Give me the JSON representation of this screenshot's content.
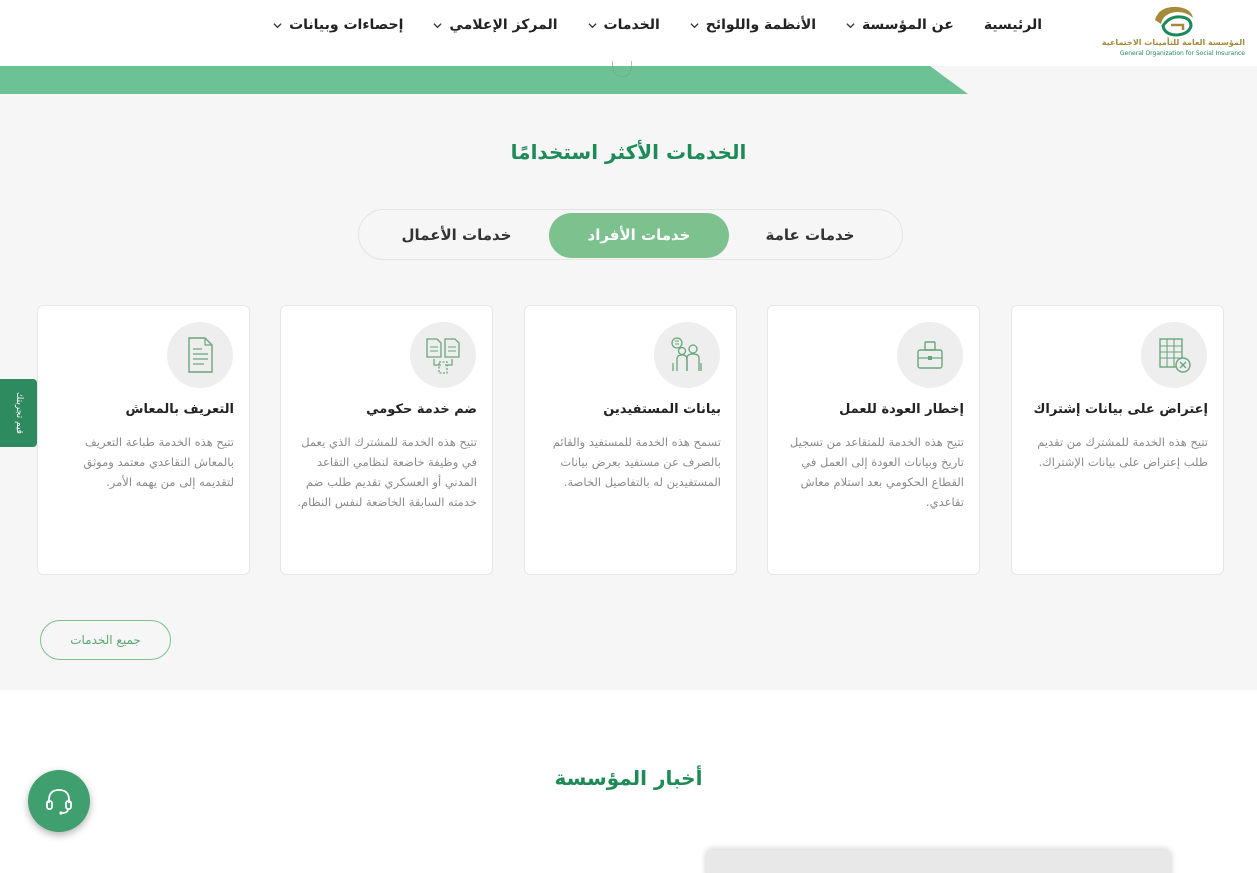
{
  "logo": {
    "arabic": "المؤسسة العامة للتأمينات الاجتماعية",
    "english": "General Organization for Social Insurance"
  },
  "nav": [
    {
      "label": "الرئيسية",
      "has_dropdown": false
    },
    {
      "label": "عن المؤسسة",
      "has_dropdown": true
    },
    {
      "label": "الأنظمة واللوائح",
      "has_dropdown": true
    },
    {
      "label": "الخدمات",
      "has_dropdown": true
    },
    {
      "label": "المركز الإعلامي",
      "has_dropdown": true
    },
    {
      "label": "إحصاءات وبيانات",
      "has_dropdown": true
    }
  ],
  "section_title": "الخدمات الأكثر استخدامًا",
  "tabs": [
    {
      "label": "خدمات عامة",
      "active": false
    },
    {
      "label": "خدمات الأفراد",
      "active": true
    },
    {
      "label": "خدمات الأعمال",
      "active": false
    }
  ],
  "cards": [
    {
      "title": "إعتراض على بيانات إشتراك",
      "description": "تتيح هذه الخدمة للمشترك من تقديم طلب إعتراض على بيانات الإشتراك.",
      "icon": "spreadsheet-x-icon"
    },
    {
      "title": "إخطار العودة للعمل",
      "description": "تتيح هذه الخدمة للمتقاعد من تسجيل تاريخ وبيانات العودة إلى العمل في القطاع الحكومي بعد استلام معاش تقاعدي.",
      "icon": "briefcase-icon"
    },
    {
      "title": "بيانات المستفيدين",
      "description": "تسمح هذه الخدمة للمستفيد والقائم بالصرف عن مستفيد بعرض بيانات المستفيدين له بالتفاصيل الخاصة.",
      "icon": "beneficiaries-icon"
    },
    {
      "title": "ضم خدمة حكومي",
      "description": "تتيح هذه الخدمة للمشترك الذي يعمل في وظيفة خاضعة لنظامي التقاعد المدني أو العسكري تقديم طلب ضم خدمته السابقة الخاضعة لنفس النظام.",
      "icon": "documents-merge-icon"
    },
    {
      "title": "التعريف بالمعاش",
      "description": "تتيح هذه الخدمة طباعة التعريف بالمعاش التقاعدي معتمد وموثق لتقديمه إلى من يهمه الأمر.",
      "icon": "document-icon"
    }
  ],
  "all_services_label": "جميع الخدمات",
  "side_tab_label": "قيم تجربتك",
  "news_title": "أخبار المؤسسة",
  "colors": {
    "primary_green": "#1e8a58",
    "tab_active": "#7cc18e",
    "band": "#6cc295"
  }
}
